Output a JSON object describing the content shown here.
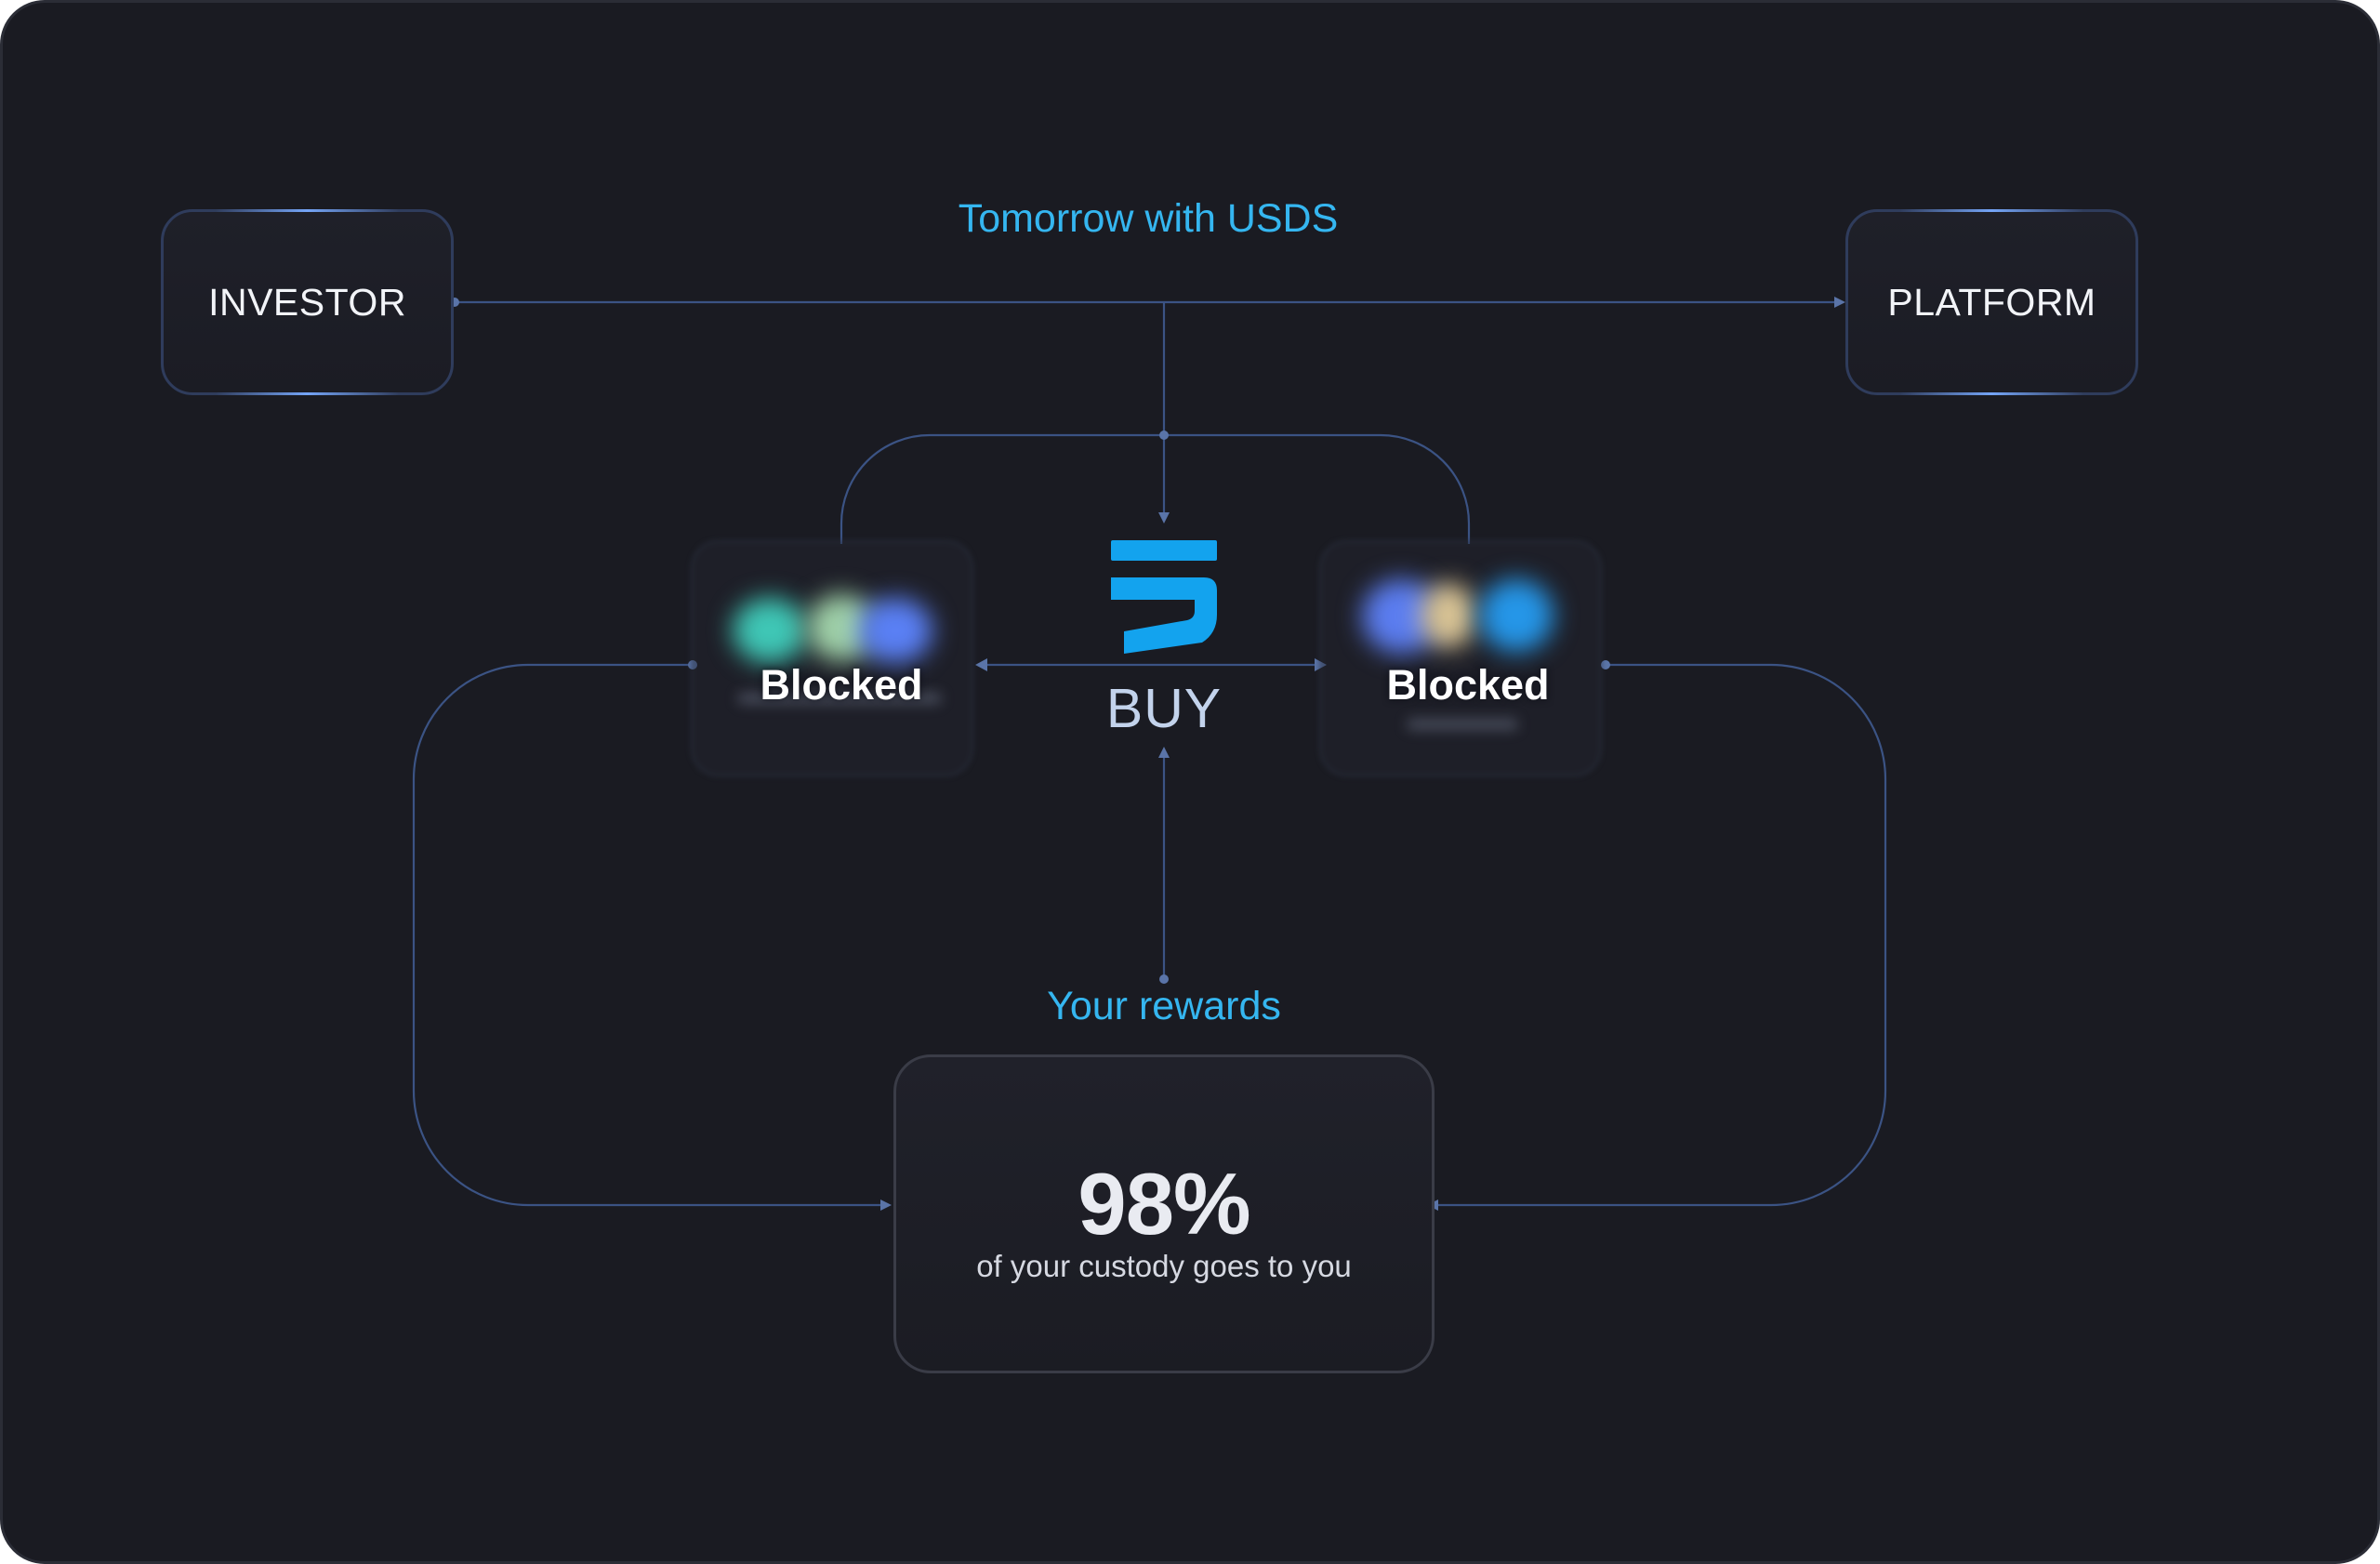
{
  "nodes": {
    "investor": "INVESTOR",
    "platform": "PLATFORM"
  },
  "captions": {
    "top": "Tomorrow with USDS",
    "rewards": "Your rewards"
  },
  "center": {
    "logo_icon": "usds-logo-icon",
    "action": "BUY"
  },
  "blocked": {
    "left": "Blocked",
    "right": "Blocked"
  },
  "rewards": {
    "percent": "98%",
    "description": "of your custody goes to you"
  },
  "colors": {
    "background": "#1a1b22",
    "accent_cyan": "#35b6f0",
    "logo_blue": "#13a3ee",
    "connector": "#3f5a8c"
  }
}
